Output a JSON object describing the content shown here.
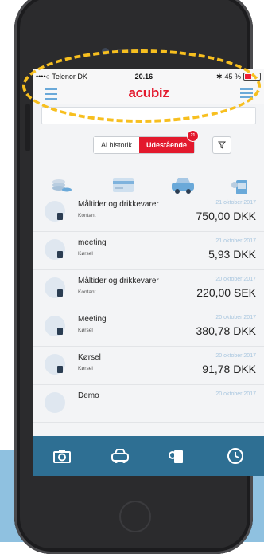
{
  "status": {
    "carrier": "••••○ Telenor DK",
    "time": "20.16",
    "battery_label": "45 %",
    "battery_level": 0.45
  },
  "nav": {
    "app_title": "acubiz"
  },
  "search": {
    "placeholder": ""
  },
  "toggle": {
    "option_all": "Al historik",
    "option_outstanding": "Udestående",
    "badge_count": "21",
    "selected": "Udestående"
  },
  "colors": {
    "brand_red": "#e3192d",
    "tab_bar": "#2e6f93",
    "accent_blue": "#6aa9d9",
    "annotation_dash": "#f7bf1f"
  },
  "category_icons": [
    "coins-icon",
    "card-icon",
    "car-icon",
    "coffee-icon"
  ],
  "items": [
    {
      "title": "Måltider og drikkevarer",
      "sub": "Kontant",
      "date": "21 oktober 2017",
      "amount": "750,00 DKK",
      "icon": "coins-icon"
    },
    {
      "title": "meeting",
      "sub": "Kørsel",
      "date": "21 oktober 2017",
      "amount": "5,93 DKK",
      "icon": "car-icon"
    },
    {
      "title": "Måltider og drikkevarer",
      "sub": "Kontant",
      "date": "20 oktober 2017",
      "amount": "220,00 SEK",
      "icon": "coins-icon"
    },
    {
      "title": "Meeting",
      "sub": "Kørsel",
      "date": "20 oktober 2017",
      "amount": "380,78 DKK",
      "icon": "car-icon"
    },
    {
      "title": "Kørsel",
      "sub": "Kørsel",
      "date": "20 oktober 2017",
      "amount": "91,78 DKK",
      "icon": "car-icon"
    },
    {
      "title": "Demo",
      "sub": "",
      "date": "20 oktober 2017",
      "amount": "",
      "icon": "car-icon"
    }
  ],
  "tabbar": [
    "camera-icon",
    "car-tab-icon",
    "coffee-tab-icon",
    "clock-icon"
  ]
}
